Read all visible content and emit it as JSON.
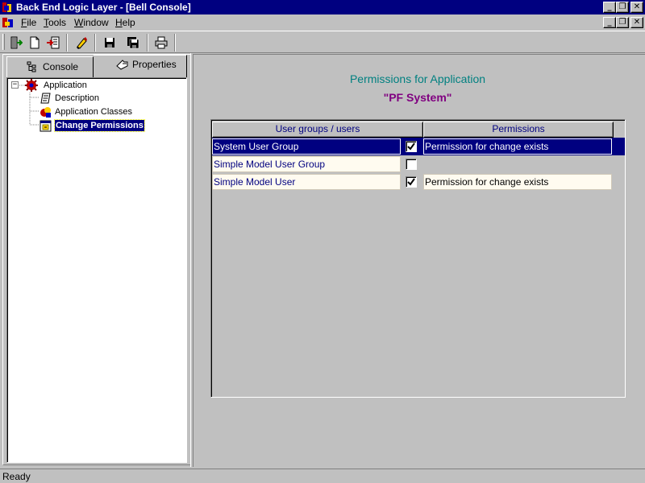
{
  "window": {
    "title": "Back End Logic Layer - [Bell Console]",
    "caption_buttons": {
      "minimize": "_",
      "restore": "❐",
      "close": "✕"
    }
  },
  "menu": {
    "items": [
      {
        "label": "File",
        "accel": "F",
        "rest": "ile"
      },
      {
        "label": "Tools",
        "accel": "T",
        "rest": "ools"
      },
      {
        "label": "Window",
        "accel": "W",
        "rest": "indow"
      },
      {
        "label": "Help",
        "accel": "H",
        "rest": "elp"
      }
    ]
  },
  "toolbar": {
    "icons": [
      "exit-icon",
      "new-document-icon",
      "import-icon",
      "edit-icon",
      "save-icon",
      "save-all-icon",
      "print-icon"
    ]
  },
  "left_panel": {
    "tabs": [
      {
        "label": "Console",
        "icon": "tree-structure-icon",
        "active": false
      },
      {
        "label": "Properties",
        "icon": "hand-pointer-icon",
        "active": true
      }
    ],
    "tree": {
      "root": {
        "label": "Application",
        "icon": "application-icon",
        "expander": "−"
      },
      "children": [
        {
          "label": "Description",
          "icon": "description-icon"
        },
        {
          "label": "Application Classes",
          "icon": "classes-icon"
        },
        {
          "label": "Change Permissions",
          "icon": "permissions-icon",
          "selected": true
        }
      ]
    }
  },
  "right_panel": {
    "heading": "Permissions for Application",
    "subheading": "\"PF System\"",
    "grid": {
      "columns": [
        "User groups / users",
        "Permissions"
      ],
      "rows": [
        {
          "name": "System User Group",
          "checked": true,
          "permission": "Permission for change exists",
          "selected": true
        },
        {
          "name": "Simple Model User Group",
          "checked": false,
          "permission": "",
          "selected": false
        },
        {
          "name": "Simple Model User",
          "checked": true,
          "permission": "Permission for change exists",
          "selected": false
        }
      ]
    }
  },
  "status": {
    "text": "Ready"
  },
  "colors": {
    "title_bar": "#000080",
    "face": "#c0c0c0",
    "heading": "#008080",
    "subheading": "#800080",
    "selection": "#000080",
    "cell_background": "#fffbf0"
  }
}
